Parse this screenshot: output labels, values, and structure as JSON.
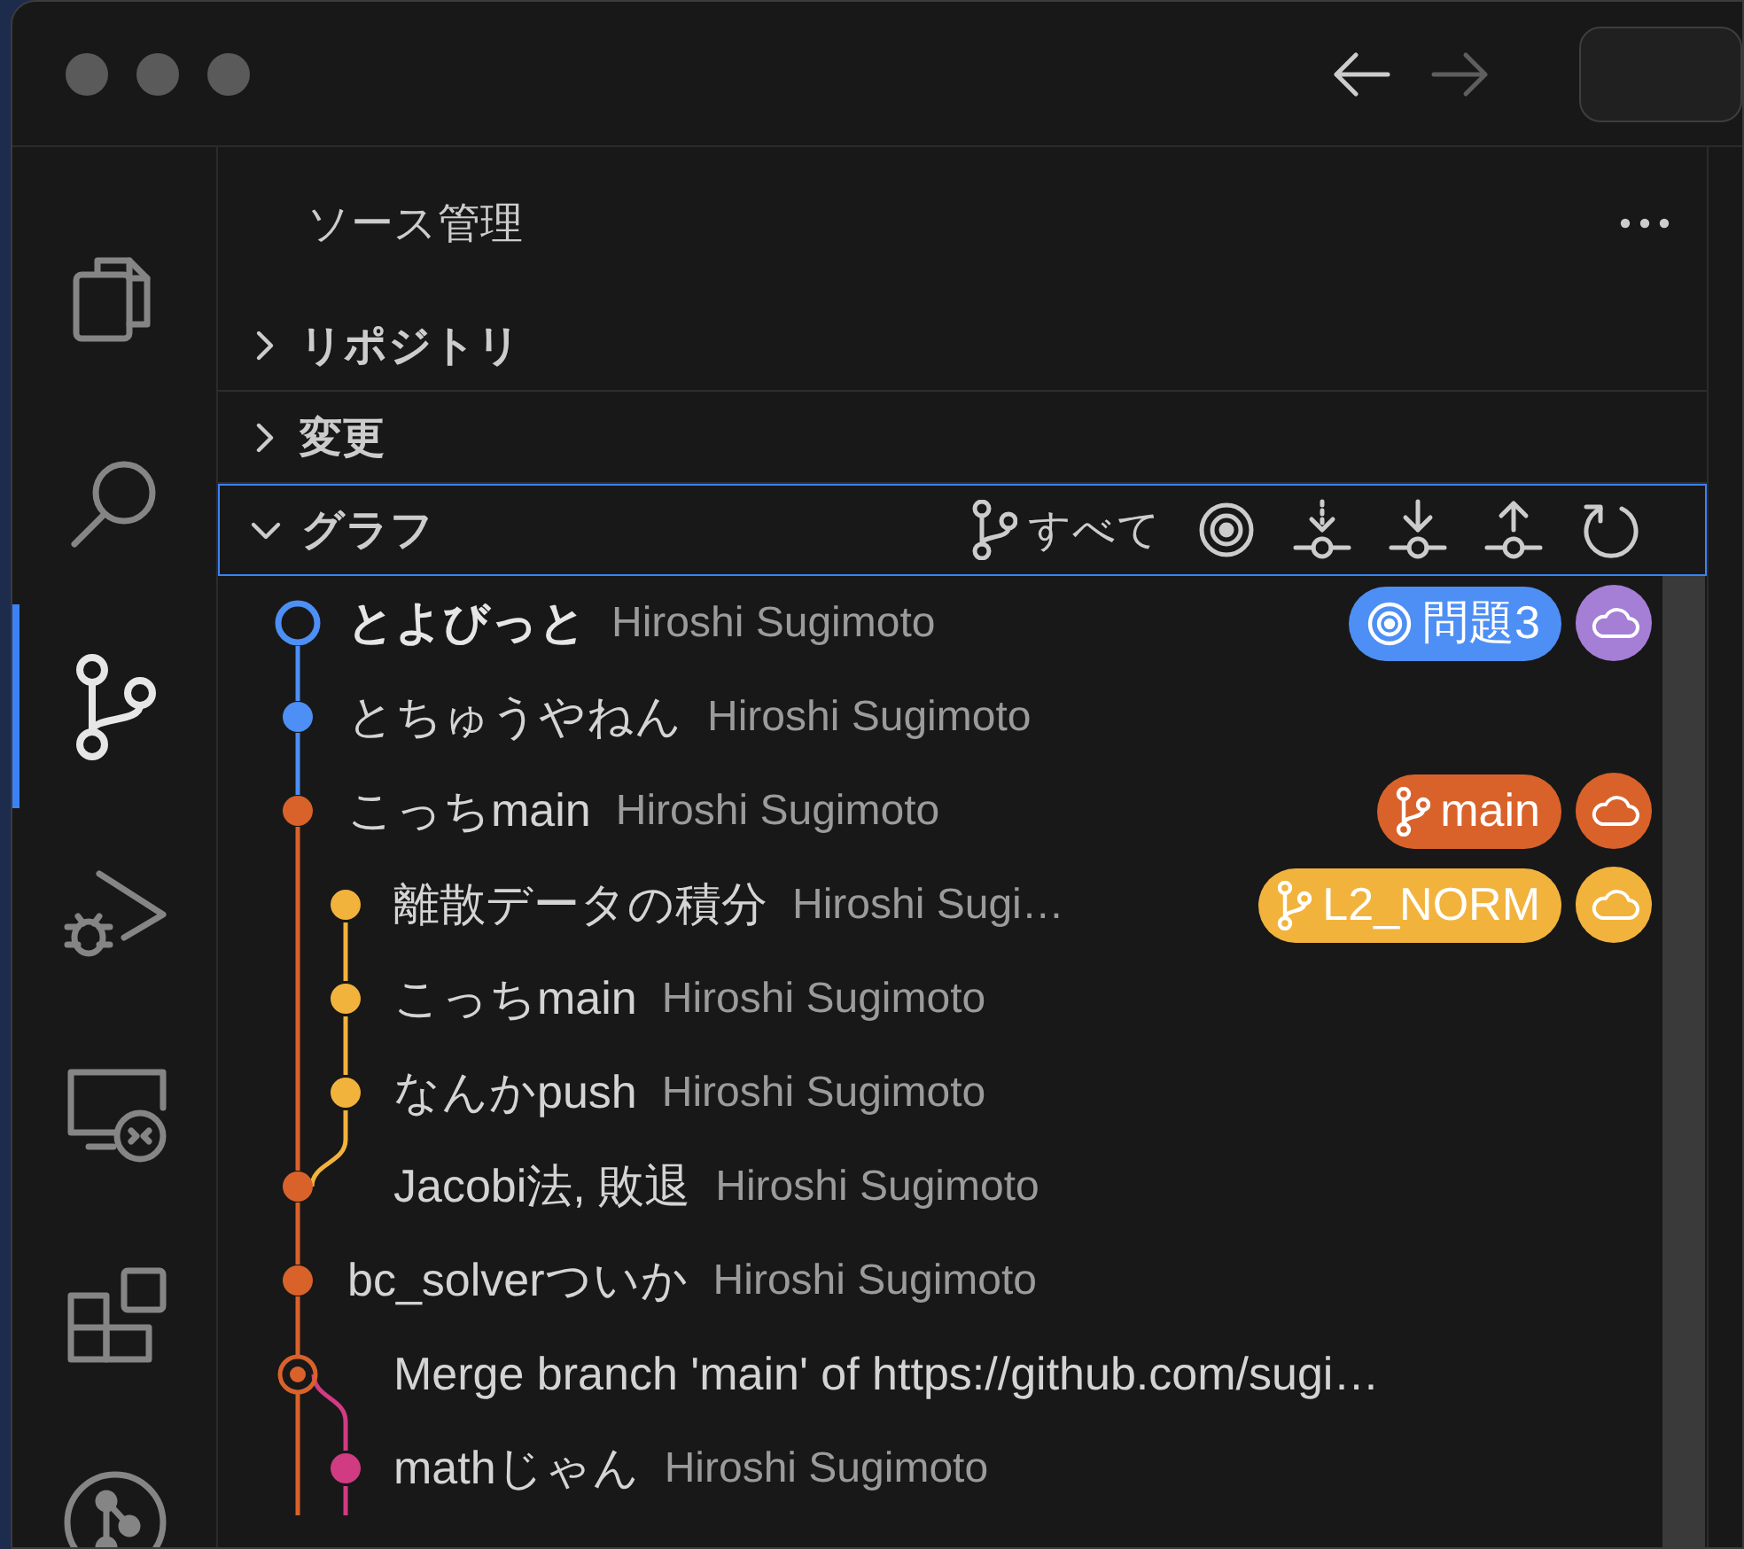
{
  "window": {
    "back": {
      "disabled": false
    },
    "forward": {
      "disabled": true
    }
  },
  "activity_bar": [
    {
      "kind": "files",
      "selected": false
    },
    {
      "kind": "search",
      "selected": false
    },
    {
      "kind": "source-control",
      "selected": true
    },
    {
      "kind": "run-debug",
      "selected": false
    },
    {
      "kind": "remote",
      "selected": false
    },
    {
      "kind": "extensions",
      "selected": false
    },
    {
      "kind": "git-graph",
      "selected": false
    }
  ],
  "sidebar": {
    "title": "ソース管理"
  },
  "sections": [
    {
      "title": "リポジトリ",
      "expanded": false,
      "focused": false
    },
    {
      "title": "変更",
      "expanded": false,
      "focused": false
    },
    {
      "title": "グラフ",
      "expanded": true,
      "focused": true,
      "toolbar": [
        {
          "kind": "branch",
          "label": "すべて"
        },
        {
          "kind": "target"
        },
        {
          "kind": "fetch"
        },
        {
          "kind": "pull"
        },
        {
          "kind": "push"
        },
        {
          "kind": "refresh"
        }
      ]
    }
  ],
  "commits": [
    {
      "kind": "head",
      "color": "#4d8ff5",
      "message": "とよびっと",
      "author": "Hiroshi Sugimoto",
      "refs": [
        {
          "kind": "issue",
          "label": "問題3",
          "color": "#4d8ff5"
        },
        {
          "kind": "remote",
          "color": "#a57ed6"
        }
      ]
    },
    {
      "kind": "commit",
      "color": "#4d8ff5",
      "message": "とちゅうやねん",
      "author": "Hiroshi Sugimoto"
    },
    {
      "kind": "commit",
      "color": "#d9622b",
      "message": "こっちmain",
      "author": "Hiroshi Sugimoto",
      "refs": [
        {
          "kind": "branch",
          "label": "main",
          "color": "#d9622b"
        },
        {
          "kind": "remote",
          "color": "#d9622b"
        }
      ]
    },
    {
      "kind": "side",
      "color": "#f2b33d",
      "message": "離散データの積分",
      "author": "Hiroshi Sugi…",
      "refs": [
        {
          "kind": "branch",
          "label": "L2_NORM",
          "color": "#f2b33d"
        },
        {
          "kind": "remote",
          "color": "#f2b33d"
        }
      ]
    },
    {
      "kind": "side",
      "color": "#f2b33d",
      "message": "こっちmain",
      "author": "Hiroshi Sugimoto"
    },
    {
      "kind": "side",
      "color": "#f2b33d",
      "message": "なんかpush",
      "author": "Hiroshi Sugimoto"
    },
    {
      "kind": "commit",
      "color": "#d9622b",
      "message": "Jacobi法, 敗退",
      "author": "Hiroshi Sugimoto"
    },
    {
      "kind": "commit",
      "color": "#d9622b",
      "message": "bc_solverついか",
      "author": "Hiroshi Sugimoto"
    },
    {
      "kind": "merge",
      "color": "#d9622b",
      "message": "Merge branch 'main' of https://github.com/sugi…"
    },
    {
      "kind": "side",
      "color": "#d13b82",
      "message": "mathじゃん",
      "author": "Hiroshi Sugimoto"
    }
  ]
}
